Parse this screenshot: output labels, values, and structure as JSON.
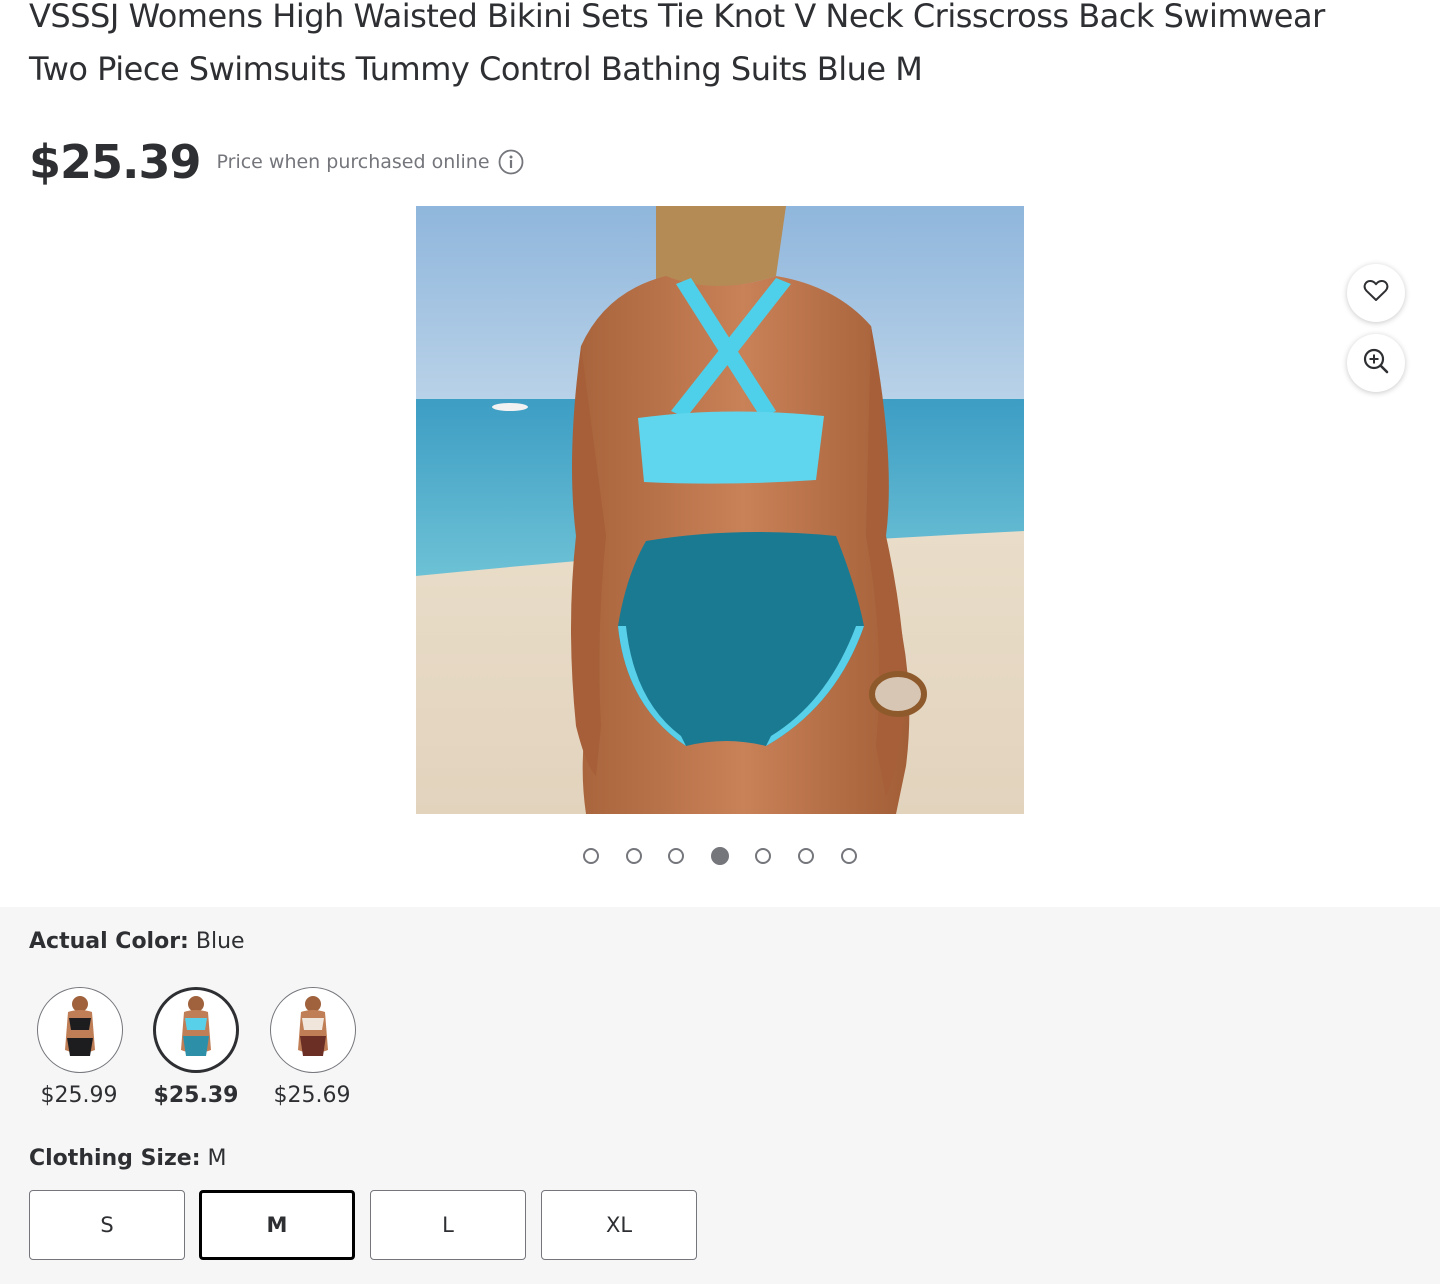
{
  "product": {
    "title": "VSSSJ Womens High Waisted Bikini Sets Tie Knot V Neck Crisscross Back Swimwear Two Piece Swimsuits Tummy Control Bathing Suits Blue M",
    "price": "$25.39",
    "price_note": "Price when purchased online",
    "info_icon": "info-circle-icon"
  },
  "gallery": {
    "image_count": 7,
    "active_index": 4,
    "favorite_icon": "heart-icon",
    "zoom_icon": "zoom-in-icon"
  },
  "color": {
    "label": "Actual Color:",
    "value": "Blue",
    "options": [
      {
        "price": "$25.99",
        "swatch_color": "#1d1d1f"
      },
      {
        "price": "$25.39",
        "swatch_color": "#2e8fa8",
        "selected": true
      },
      {
        "price": "$25.69",
        "swatch_color": "#6b2f26"
      }
    ]
  },
  "size": {
    "label": "Clothing Size:",
    "value": "M",
    "options": [
      "S",
      "M",
      "L",
      "XL"
    ],
    "selected": "M"
  }
}
